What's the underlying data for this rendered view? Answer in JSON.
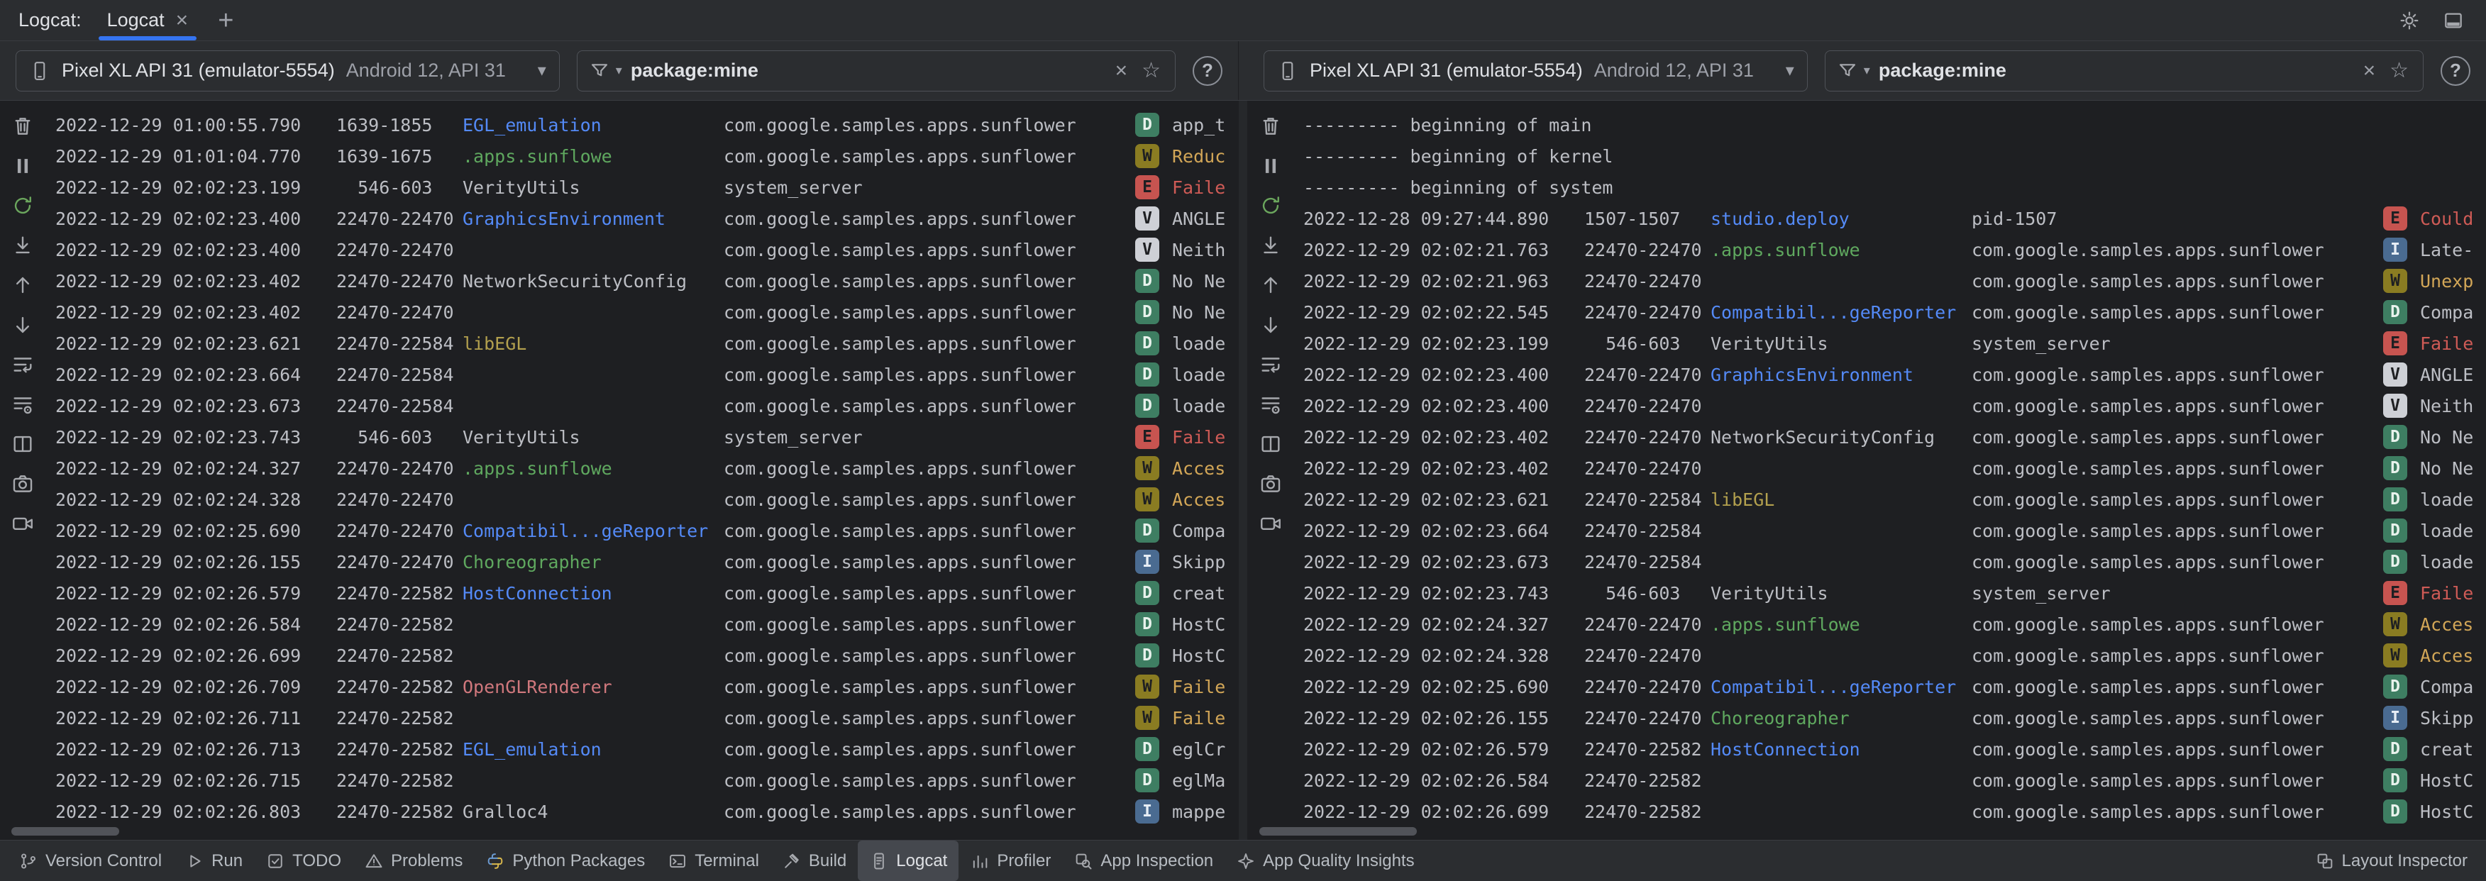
{
  "window": {
    "title_label": "Logcat:"
  },
  "tab_bar": {
    "tabs": [
      {
        "label": "Logcat",
        "close": "×",
        "active": true
      }
    ],
    "add_button": "+"
  },
  "colors": {
    "accent": "#3574F0",
    "log_meta": "#BCBEC4",
    "levels": {
      "V": {
        "bg": "#CED0D6",
        "fg": "#1E1F22"
      },
      "D": {
        "bg": "#3E7E62",
        "fg": "#E8F2EC"
      },
      "I": {
        "bg": "#4A6B91",
        "fg": "#E6EDF5"
      },
      "W": {
        "bg": "#8A7C22",
        "fg": "#1E1F22"
      },
      "E": {
        "bg": "#C75450",
        "fg": "#1E1F22"
      }
    },
    "msg": {
      "V": "#BCBEC4",
      "D": "#BCBEC4",
      "I": "#BCBEC4",
      "W": "#D2A657",
      "E": "#CF5B56"
    },
    "tags": {
      "blue": "#548AF7",
      "green": "#5FA85F",
      "olive": "#B3A04E",
      "salmon": "#D0787D",
      "default": "#BCBEC4"
    }
  },
  "pane_tool_icons": [
    {
      "button": "clear-logcat-button",
      "icon": "trash-icon"
    },
    {
      "button": "pause-logcat-button",
      "icon": "pause-icon"
    },
    {
      "button": "restart-logcat-button",
      "icon": "restart-icon"
    },
    {
      "button": "scroll-to-end-button",
      "icon": "scroll-to-end-icon"
    },
    {
      "button": "previous-occurrence-button",
      "icon": "arrow-up-icon"
    },
    {
      "button": "next-occurrence-button",
      "icon": "arrow-down-icon"
    },
    {
      "button": "soft-wrap-button",
      "icon": "soft-wrap-icon"
    },
    {
      "button": "format-options-button",
      "icon": "format-lines-icon"
    },
    {
      "button": "split-panels-button",
      "icon": "split-panels-icon"
    },
    {
      "button": "screenshot-button",
      "icon": "camera-icon"
    },
    {
      "button": "screen-record-button",
      "icon": "video-camera-icon"
    }
  ],
  "panes": [
    {
      "device": {
        "name": "Pixel XL API 31 (emulator-5554)",
        "details": "Android 12, API 31",
        "chevron": "▾"
      },
      "filter": {
        "value": "package:mine",
        "clear": "×",
        "favorite": "☆",
        "chevron": "▾"
      },
      "help": "?",
      "rows": [
        {
          "t": "2022-12-29 01:00:55.790",
          "p": "1639-1855",
          "g": "EGL_emulation",
          "gc": "blue",
          "k": "com.google.samples.apps.sunflower",
          "l": "D",
          "m": "app_t"
        },
        {
          "t": "2022-12-29 01:01:04.770",
          "p": "1639-1675",
          "g": ".apps.sunflowe",
          "gc": "green",
          "k": "com.google.samples.apps.sunflower",
          "l": "W",
          "m": "Reduc"
        },
        {
          "t": "2022-12-29 02:02:23.199",
          "p": "  546-603",
          "g": "VerityUtils",
          "gc": "default",
          "k": "system_server",
          "l": "E",
          "m": "Faile"
        },
        {
          "t": "2022-12-29 02:02:23.400",
          "p": "22470-22470",
          "g": "GraphicsEnvironment",
          "gc": "blue",
          "k": "com.google.samples.apps.sunflower",
          "l": "V",
          "m": "ANGLE"
        },
        {
          "t": "2022-12-29 02:02:23.400",
          "p": "22470-22470",
          "g": "",
          "k": "com.google.samples.apps.sunflower",
          "l": "V",
          "m": "Neith"
        },
        {
          "t": "2022-12-29 02:02:23.402",
          "p": "22470-22470",
          "g": "NetworkSecurityConfig",
          "gc": "default",
          "k": "com.google.samples.apps.sunflower",
          "l": "D",
          "m": "No Ne"
        },
        {
          "t": "2022-12-29 02:02:23.402",
          "p": "22470-22470",
          "g": "",
          "k": "com.google.samples.apps.sunflower",
          "l": "D",
          "m": "No Ne"
        },
        {
          "t": "2022-12-29 02:02:23.621",
          "p": "22470-22584",
          "g": "libEGL",
          "gc": "olive",
          "k": "com.google.samples.apps.sunflower",
          "l": "D",
          "m": "loade"
        },
        {
          "t": "2022-12-29 02:02:23.664",
          "p": "22470-22584",
          "g": "",
          "k": "com.google.samples.apps.sunflower",
          "l": "D",
          "m": "loade"
        },
        {
          "t": "2022-12-29 02:02:23.673",
          "p": "22470-22584",
          "g": "",
          "k": "com.google.samples.apps.sunflower",
          "l": "D",
          "m": "loade"
        },
        {
          "t": "2022-12-29 02:02:23.743",
          "p": "  546-603",
          "g": "VerityUtils",
          "gc": "default",
          "k": "system_server",
          "l": "E",
          "m": "Faile"
        },
        {
          "t": "2022-12-29 02:02:24.327",
          "p": "22470-22470",
          "g": ".apps.sunflowe",
          "gc": "green",
          "k": "com.google.samples.apps.sunflower",
          "l": "W",
          "m": "Acces"
        },
        {
          "t": "2022-12-29 02:02:24.328",
          "p": "22470-22470",
          "g": "",
          "k": "com.google.samples.apps.sunflower",
          "l": "W",
          "m": "Acces"
        },
        {
          "t": "2022-12-29 02:02:25.690",
          "p": "22470-22470",
          "g": "Compatibil...geReporter",
          "gc": "blue",
          "k": "com.google.samples.apps.sunflower",
          "l": "D",
          "m": "Compa"
        },
        {
          "t": "2022-12-29 02:02:26.155",
          "p": "22470-22470",
          "g": "Choreographer",
          "gc": "green",
          "k": "com.google.samples.apps.sunflower",
          "l": "I",
          "m": "Skipp"
        },
        {
          "t": "2022-12-29 02:02:26.579",
          "p": "22470-22582",
          "g": "HostConnection",
          "gc": "blue",
          "k": "com.google.samples.apps.sunflower",
          "l": "D",
          "m": "creat"
        },
        {
          "t": "2022-12-29 02:02:26.584",
          "p": "22470-22582",
          "g": "",
          "k": "com.google.samples.apps.sunflower",
          "l": "D",
          "m": "HostC"
        },
        {
          "t": "2022-12-29 02:02:26.699",
          "p": "22470-22582",
          "g": "",
          "k": "com.google.samples.apps.sunflower",
          "l": "D",
          "m": "HostC"
        },
        {
          "t": "2022-12-29 02:02:26.709",
          "p": "22470-22582",
          "g": "OpenGLRenderer",
          "gc": "salmon",
          "k": "com.google.samples.apps.sunflower",
          "l": "W",
          "m": "Faile"
        },
        {
          "t": "2022-12-29 02:02:26.711",
          "p": "22470-22582",
          "g": "",
          "k": "com.google.samples.apps.sunflower",
          "l": "W",
          "m": "Faile"
        },
        {
          "t": "2022-12-29 02:02:26.713",
          "p": "22470-22582",
          "g": "EGL_emulation",
          "gc": "blue",
          "k": "com.google.samples.apps.sunflower",
          "l": "D",
          "m": "eglCr"
        },
        {
          "t": "2022-12-29 02:02:26.715",
          "p": "22470-22582",
          "g": "",
          "k": "com.google.samples.apps.sunflower",
          "l": "D",
          "m": "eglMa"
        },
        {
          "t": "2022-12-29 02:02:26.803",
          "p": "22470-22582",
          "g": "Gralloc4",
          "gc": "default",
          "k": "com.google.samples.apps.sunflower",
          "l": "I",
          "m": "mappe"
        }
      ]
    },
    {
      "device": {
        "name": "Pixel XL API 31 (emulator-5554)",
        "details": "Android 12, API 31",
        "chevron": "▾"
      },
      "filter": {
        "value": "package:mine",
        "clear": "×",
        "favorite": "☆",
        "chevron": "▾"
      },
      "help": "?",
      "rows": [
        {
          "b": "--------- beginning of main"
        },
        {
          "b": "--------- beginning of kernel"
        },
        {
          "b": "--------- beginning of system"
        },
        {
          "t": "2022-12-28 09:27:44.890",
          "p": "1507-1507",
          "g": "studio.deploy",
          "gc": "blue",
          "k": "pid-1507",
          "l": "E",
          "m": "Could"
        },
        {
          "t": "2022-12-29 02:02:21.763",
          "p": "22470-22470",
          "g": ".apps.sunflowe",
          "gc": "green",
          "k": "com.google.samples.apps.sunflower",
          "l": "I",
          "m": "Late-"
        },
        {
          "t": "2022-12-29 02:02:21.963",
          "p": "22470-22470",
          "g": "",
          "k": "com.google.samples.apps.sunflower",
          "l": "W",
          "m": "Unexp"
        },
        {
          "t": "2022-12-29 02:02:22.545",
          "p": "22470-22470",
          "g": "Compatibil...geReporter",
          "gc": "blue",
          "k": "com.google.samples.apps.sunflower",
          "l": "D",
          "m": "Compa"
        },
        {
          "t": "2022-12-29 02:02:23.199",
          "p": "  546-603",
          "g": "VerityUtils",
          "gc": "default",
          "k": "system_server",
          "l": "E",
          "m": "Faile"
        },
        {
          "t": "2022-12-29 02:02:23.400",
          "p": "22470-22470",
          "g": "GraphicsEnvironment",
          "gc": "blue",
          "k": "com.google.samples.apps.sunflower",
          "l": "V",
          "m": "ANGLE"
        },
        {
          "t": "2022-12-29 02:02:23.400",
          "p": "22470-22470",
          "g": "",
          "k": "com.google.samples.apps.sunflower",
          "l": "V",
          "m": "Neith"
        },
        {
          "t": "2022-12-29 02:02:23.402",
          "p": "22470-22470",
          "g": "NetworkSecurityConfig",
          "gc": "default",
          "k": "com.google.samples.apps.sunflower",
          "l": "D",
          "m": "No Ne"
        },
        {
          "t": "2022-12-29 02:02:23.402",
          "p": "22470-22470",
          "g": "",
          "k": "com.google.samples.apps.sunflower",
          "l": "D",
          "m": "No Ne"
        },
        {
          "t": "2022-12-29 02:02:23.621",
          "p": "22470-22584",
          "g": "libEGL",
          "gc": "olive",
          "k": "com.google.samples.apps.sunflower",
          "l": "D",
          "m": "loade"
        },
        {
          "t": "2022-12-29 02:02:23.664",
          "p": "22470-22584",
          "g": "",
          "k": "com.google.samples.apps.sunflower",
          "l": "D",
          "m": "loade"
        },
        {
          "t": "2022-12-29 02:02:23.673",
          "p": "22470-22584",
          "g": "",
          "k": "com.google.samples.apps.sunflower",
          "l": "D",
          "m": "loade"
        },
        {
          "t": "2022-12-29 02:02:23.743",
          "p": "  546-603",
          "g": "VerityUtils",
          "gc": "default",
          "k": "system_server",
          "l": "E",
          "m": "Faile"
        },
        {
          "t": "2022-12-29 02:02:24.327",
          "p": "22470-22470",
          "g": ".apps.sunflowe",
          "gc": "green",
          "k": "com.google.samples.apps.sunflower",
          "l": "W",
          "m": "Acces"
        },
        {
          "t": "2022-12-29 02:02:24.328",
          "p": "22470-22470",
          "g": "",
          "k": "com.google.samples.apps.sunflower",
          "l": "W",
          "m": "Acces"
        },
        {
          "t": "2022-12-29 02:02:25.690",
          "p": "22470-22470",
          "g": "Compatibil...geReporter",
          "gc": "blue",
          "k": "com.google.samples.apps.sunflower",
          "l": "D",
          "m": "Compa"
        },
        {
          "t": "2022-12-29 02:02:26.155",
          "p": "22470-22470",
          "g": "Choreographer",
          "gc": "green",
          "k": "com.google.samples.apps.sunflower",
          "l": "I",
          "m": "Skipp"
        },
        {
          "t": "2022-12-29 02:02:26.579",
          "p": "22470-22582",
          "g": "HostConnection",
          "gc": "blue",
          "k": "com.google.samples.apps.sunflower",
          "l": "D",
          "m": "creat"
        },
        {
          "t": "2022-12-29 02:02:26.584",
          "p": "22470-22582",
          "g": "",
          "k": "com.google.samples.apps.sunflower",
          "l": "D",
          "m": "HostC"
        },
        {
          "t": "2022-12-29 02:02:26.699",
          "p": "22470-22582",
          "g": "",
          "k": "com.google.samples.apps.sunflower",
          "l": "D",
          "m": "HostC"
        }
      ]
    }
  ],
  "status_bar": {
    "left": [
      {
        "icon": "version-control-icon",
        "label": "Version Control"
      },
      {
        "icon": "run-icon",
        "label": "Run"
      },
      {
        "icon": "todo-icon",
        "label": "TODO"
      },
      {
        "icon": "problems-icon",
        "label": "Problems"
      },
      {
        "icon": "python-packages-icon",
        "label": "Python Packages"
      },
      {
        "icon": "terminal-icon",
        "label": "Terminal"
      },
      {
        "icon": "build-icon",
        "label": "Build"
      },
      {
        "icon": "logcat-icon",
        "label": "Logcat",
        "active": true
      },
      {
        "icon": "profiler-icon",
        "label": "Profiler"
      },
      {
        "icon": "app-inspection-icon",
        "label": "App Inspection"
      },
      {
        "icon": "app-quality-insights-icon",
        "label": "App Quality Insights"
      }
    ],
    "right": [
      {
        "icon": "layout-inspector-icon",
        "label": "Layout Inspector"
      }
    ]
  }
}
